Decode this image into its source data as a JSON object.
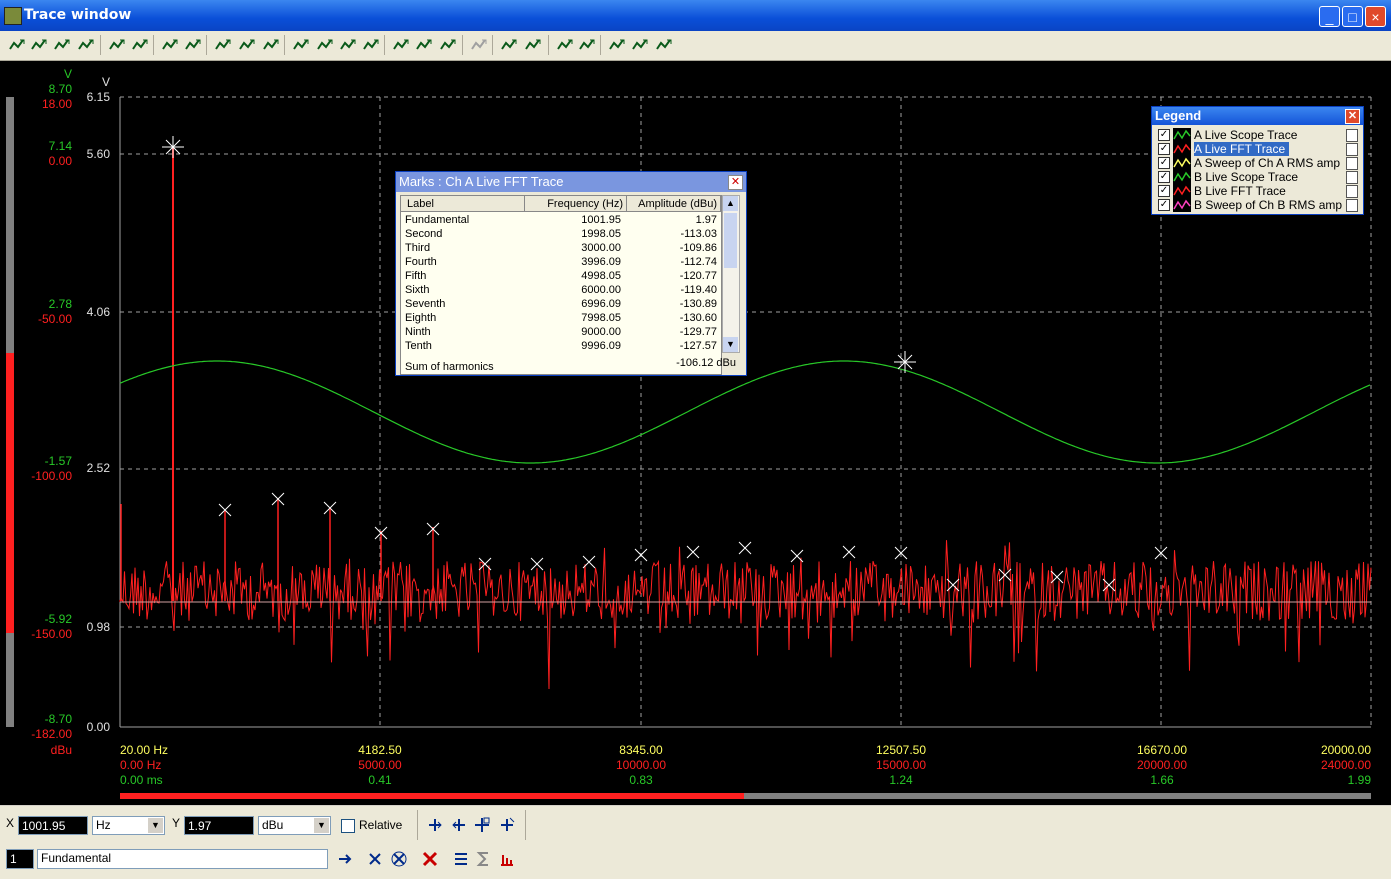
{
  "window": {
    "title": "Trace window",
    "minimize": "_",
    "maximize": "□",
    "close": "×"
  },
  "toolbar": {
    "icons": [
      "trace-add-icon",
      "trace-wave-icon",
      "save-icon",
      "copy-icon",
      "graph-icon",
      "graph-table-icon",
      "grid-icon",
      "numeric-icon",
      "zoom-fit-icon",
      "zoom-x-icon",
      "wave-icon",
      "peak-left-icon",
      "peak-up-icon",
      "peak-down-icon",
      "peak-right-icon",
      "zoom-in-icon",
      "zoom-out-icon",
      "auto-scale-icon",
      "disabled-icon",
      "cursor-up-icon",
      "cursor-down-icon",
      "mark-add-icon",
      "mark-move-icon",
      "arrow-up-icon",
      "reference-icon",
      "settings-icon"
    ]
  },
  "axes": {
    "unit_green": "V",
    "unit_white": "V",
    "unit_red": "dBu",
    "green_ticks": [
      "8.70",
      "7.14",
      "2.78",
      "-1.57",
      "-5.92",
      "-8.70"
    ],
    "red_ticks": [
      "18.00",
      "0.00",
      "-50.00",
      "-100.00",
      "-150.00",
      "-182.00"
    ],
    "white_ticks": [
      "6.15",
      "5.60",
      "4.06",
      "2.52",
      "0.98",
      "0.00"
    ],
    "x_yellow": [
      "20.00 Hz",
      "4182.50",
      "8345.00",
      "12507.50",
      "16670.00",
      "20000.00"
    ],
    "x_red": [
      "0.00 Hz",
      "5000.00",
      "10000.00",
      "15000.00",
      "20000.00",
      "24000.00"
    ],
    "x_green": [
      "0.00 ms",
      "0.41",
      "0.83",
      "1.24",
      "1.66",
      "1.99"
    ]
  },
  "colors": {
    "fft": "#ff2020",
    "scope": "#28c828",
    "grid": "#a0a0a0",
    "mark": "#ffffff",
    "yellow": "#ffff60"
  },
  "marks_panel": {
    "title": "Marks : Ch A Live FFT Trace",
    "col_label": "Label",
    "col_freq": "Frequency (Hz)",
    "col_amp": "Amplitude (dBu)",
    "rows": [
      {
        "label": "Fundamental",
        "freq": "1001.95",
        "amp": "1.97"
      },
      {
        "label": "Second",
        "freq": "1998.05",
        "amp": "-113.03"
      },
      {
        "label": "Third",
        "freq": "3000.00",
        "amp": "-109.86"
      },
      {
        "label": "Fourth",
        "freq": "3996.09",
        "amp": "-112.74"
      },
      {
        "label": "Fifth",
        "freq": "4998.05",
        "amp": "-120.77"
      },
      {
        "label": "Sixth",
        "freq": "6000.00",
        "amp": "-119.40"
      },
      {
        "label": "Seventh",
        "freq": "6996.09",
        "amp": "-130.89"
      },
      {
        "label": "Eighth",
        "freq": "7998.05",
        "amp": "-130.60"
      },
      {
        "label": "Ninth",
        "freq": "9000.00",
        "amp": "-129.77"
      },
      {
        "label": "Tenth",
        "freq": "9996.09",
        "amp": "-127.57"
      }
    ],
    "sum_label": "Sum of harmonics",
    "sum_value": "-106.12 dBu"
  },
  "legend": {
    "title": "Legend",
    "items": [
      {
        "label": "A Live Scope Trace",
        "checked": "✓",
        "color": "#28c828"
      },
      {
        "label": "A Live FFT Trace",
        "checked": "✓",
        "color": "#ff2020"
      },
      {
        "label": "A Sweep of Ch A RMS amp",
        "checked": "✓",
        "color": "#ffff60"
      },
      {
        "label": "B Live Scope Trace",
        "checked": "✓",
        "color": "#28c828"
      },
      {
        "label": "B Live FFT Trace",
        "checked": "✓",
        "color": "#ff2020"
      },
      {
        "label": "B Sweep of Ch B RMS amp",
        "checked": "✓",
        "color": "#ff40c0"
      }
    ]
  },
  "cursor": {
    "x_label": "X",
    "x_value": "1001.95",
    "x_unit": "Hz",
    "y_label": "Y",
    "y_value": "1.97",
    "y_unit": "dBu",
    "relative_label": "Relative",
    "mark_index": "1",
    "mark_name": "Fundamental"
  }
}
